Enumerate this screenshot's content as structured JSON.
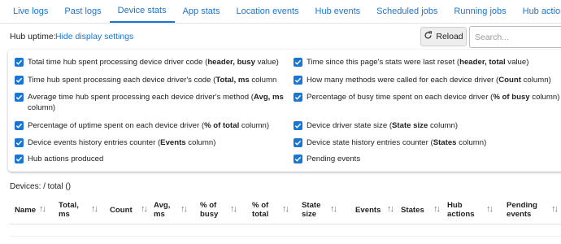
{
  "tabs": [
    {
      "label": "Live logs"
    },
    {
      "label": "Past logs"
    },
    {
      "label": "Device stats",
      "active": true
    },
    {
      "label": "App stats"
    },
    {
      "label": "Location events"
    },
    {
      "label": "Hub events"
    },
    {
      "label": "Scheduled jobs"
    },
    {
      "label": "Running jobs"
    },
    {
      "label": "Hub actions"
    }
  ],
  "toolbar": {
    "uptime_label": "Hub uptime:",
    "hide_link": "Hide display settings",
    "reload_label": "Reload",
    "search_placeholder": "Search..."
  },
  "options": {
    "o1": {
      "pre": "Total time hub spent processing device driver code (",
      "bold": "header, busy",
      "post": " value)",
      "checked": true
    },
    "o2": {
      "pre": "Time since this page's stats were last reset (",
      "bold": "header, total",
      "post": " value)",
      "checked": true
    },
    "o3": {
      "pre": "Time hub spent processing each device driver's code (",
      "bold": "Total, ms",
      "post": " column",
      "checked": true
    },
    "o4": {
      "pre": "How many methods were called for each device driver (",
      "bold": "Count",
      "post": " column)",
      "checked": true
    },
    "o5": {
      "pre": "Average time hub spent processing each device driver's method (",
      "bold": "Avg, ms",
      "post": " column)",
      "checked": true
    },
    "o6": {
      "pre": "Percentage of busy time spent on each device driver (",
      "bold": "% of busy",
      "post": " column)",
      "checked": true
    },
    "o7": {
      "pre": "Percentage of uptime spent on each device driver (",
      "bold": "% of total",
      "post": " column)",
      "checked": true
    },
    "o8": {
      "pre": "Device driver state size (",
      "bold": "State size",
      "post": " column)",
      "checked": true
    },
    "o9": {
      "pre": "Device events history entries counter (",
      "bold": "Events",
      "post": " column)",
      "checked": true
    },
    "o10": {
      "pre": "Device state history entries counter (",
      "bold": "States",
      "post": " column)",
      "checked": true
    },
    "o11": {
      "pre": "Hub actions produced",
      "bold": "",
      "post": "",
      "checked": true
    },
    "o12": {
      "pre": "Pending events",
      "bold": "",
      "post": "",
      "checked": true
    }
  },
  "devices_line": "Devices: / total ()",
  "columns": {
    "c1": {
      "l1": "Name",
      "l2": ""
    },
    "c2": {
      "l1": "Total,",
      "l2": "ms"
    },
    "c3": {
      "l1": "Count",
      "l2": ""
    },
    "c4": {
      "l1": "Avg,",
      "l2": "ms"
    },
    "c5": {
      "l1": "% of",
      "l2": "busy"
    },
    "c6": {
      "l1": "% of",
      "l2": "total"
    },
    "c7": {
      "l1": "State",
      "l2": "size"
    },
    "c8": {
      "l1": "Events",
      "l2": ""
    },
    "c9": {
      "l1": "States",
      "l2": ""
    },
    "c10": {
      "l1": "Hub",
      "l2": "actions"
    },
    "c11": {
      "l1": "Pending",
      "l2": "events"
    }
  },
  "sort_glyph": "↑↓",
  "colors": {
    "accent": "#1976d2"
  }
}
